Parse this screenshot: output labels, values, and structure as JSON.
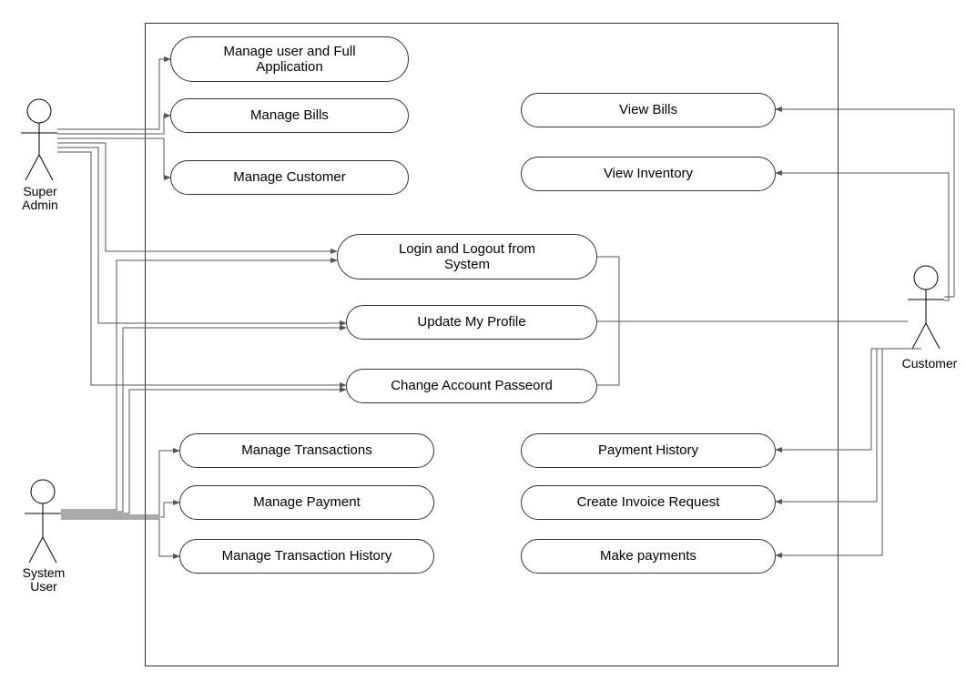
{
  "diagram_type": "UML Use Case Diagram",
  "actors": {
    "super_admin": "Super\nAdmin",
    "system_user": "System\nUser",
    "customer": "Customer"
  },
  "usecases": {
    "manage_app": "Manage user and Full\nApplication",
    "manage_bills": "Manage Bills",
    "manage_customer": "Manage Customer",
    "view_bills": "View Bills",
    "view_inventory": "View Inventory",
    "login_logout": "Login and Logout from\nSystem",
    "update_profile": "Update My Profile",
    "change_password": "Change Account Passeord",
    "manage_transactions": "Manage Transactions",
    "manage_payment": "Manage Payment",
    "manage_tx_history": "Manage Transaction History",
    "payment_history": "Payment History",
    "create_invoice": "Create Invoice Request",
    "make_payments": "Make payments"
  },
  "chart_data": {
    "type": "use-case-diagram",
    "actors": [
      "Super Admin",
      "System User",
      "Customer"
    ],
    "use_cases": [
      "Manage user and Full Application",
      "Manage Bills",
      "Manage Customer",
      "View Bills",
      "View Inventory",
      "Login and Logout from System",
      "Update My Profile",
      "Change Account Passeord",
      "Manage Transactions",
      "Manage Payment",
      "Manage Transaction History",
      "Payment History",
      "Create Invoice Request",
      "Make payments"
    ],
    "associations": [
      {
        "actor": "Super Admin",
        "use_case": "Manage user and Full Application"
      },
      {
        "actor": "Super Admin",
        "use_case": "Manage Bills"
      },
      {
        "actor": "Super Admin",
        "use_case": "Manage Customer"
      },
      {
        "actor": "Super Admin",
        "use_case": "Login and Logout from System"
      },
      {
        "actor": "Super Admin",
        "use_case": "Update My Profile"
      },
      {
        "actor": "Super Admin",
        "use_case": "Change Account Passeord"
      },
      {
        "actor": "System User",
        "use_case": "Login and Logout from System"
      },
      {
        "actor": "System User",
        "use_case": "Update My Profile"
      },
      {
        "actor": "System User",
        "use_case": "Change Account Passeord"
      },
      {
        "actor": "System User",
        "use_case": "Manage Transactions"
      },
      {
        "actor": "System User",
        "use_case": "Manage Payment"
      },
      {
        "actor": "System User",
        "use_case": "Manage Transaction History"
      },
      {
        "actor": "Customer",
        "use_case": "View Bills"
      },
      {
        "actor": "Customer",
        "use_case": "View Inventory"
      },
      {
        "actor": "Customer",
        "use_case": "Login and Logout from System"
      },
      {
        "actor": "Customer",
        "use_case": "Update My Profile"
      },
      {
        "actor": "Customer",
        "use_case": "Change Account Passeord"
      },
      {
        "actor": "Customer",
        "use_case": "Payment History"
      },
      {
        "actor": "Customer",
        "use_case": "Create Invoice Request"
      },
      {
        "actor": "Customer",
        "use_case": "Make payments"
      }
    ]
  }
}
